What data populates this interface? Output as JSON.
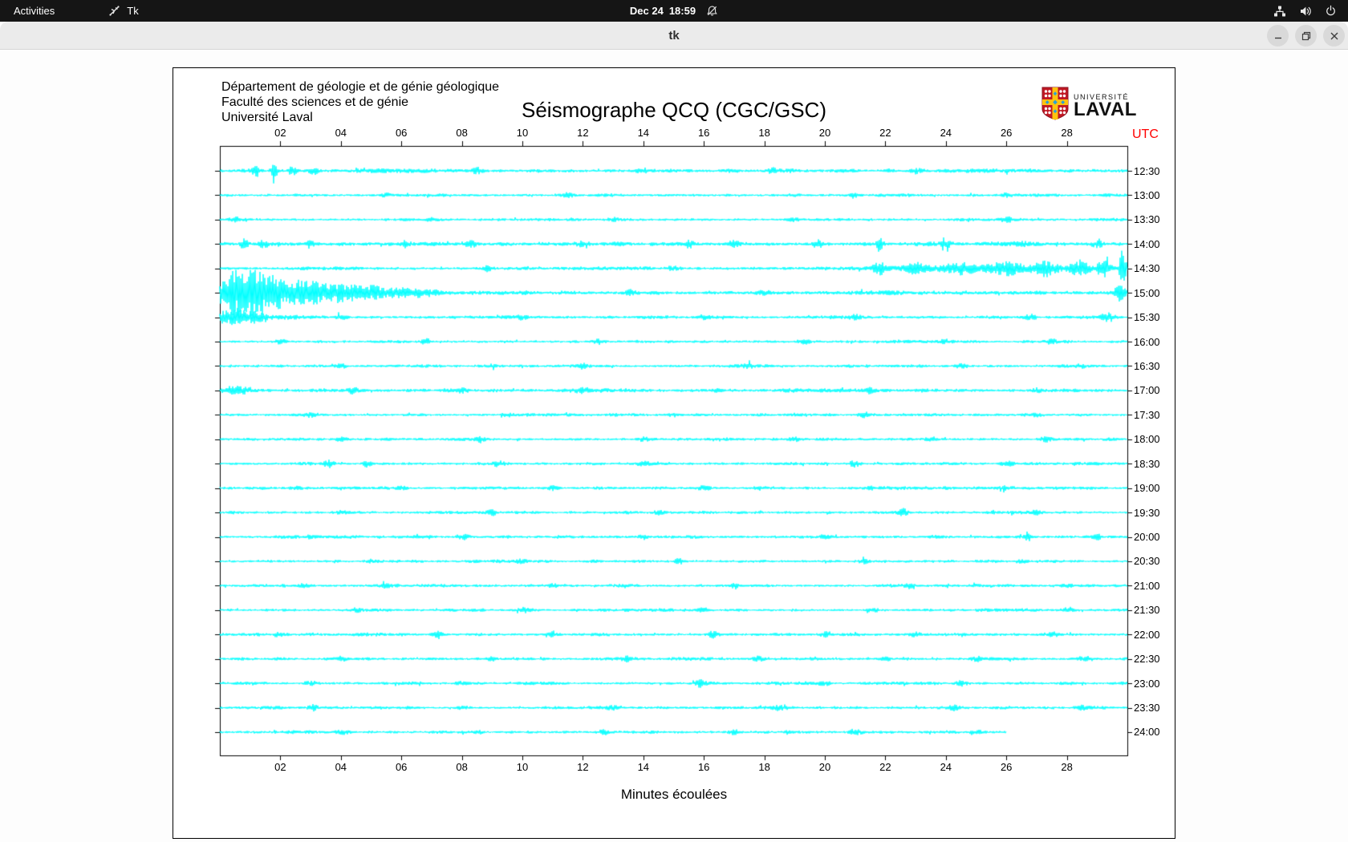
{
  "top_bar": {
    "activities_label": "Activities",
    "app_name": "Tk",
    "date": "Dec 24",
    "time": "18:59",
    "icons": {
      "app": "tk-icon",
      "notifications": "bell-muted-icon",
      "network": "wired-network-icon",
      "audio": "volume-icon",
      "power": "power-icon"
    }
  },
  "window": {
    "title": "tk",
    "buttons": [
      "minimize",
      "maximize",
      "close"
    ]
  },
  "seismograph": {
    "header_lines": [
      "Département de géologie et de génie géologique",
      "Faculté des sciences et de génie",
      "Université Laval"
    ],
    "title": "Séismographe QCQ (CGC/GSC)",
    "logo": {
      "line1": "UNIVERSITÉ",
      "line2": "LAVAL"
    },
    "utc_label": "UTC",
    "xlabel": "Minutes écoulées",
    "x_tick_labels": [
      "02",
      "04",
      "06",
      "08",
      "10",
      "12",
      "14",
      "16",
      "18",
      "20",
      "22",
      "24",
      "26",
      "28"
    ],
    "colors": {
      "trace": "#00ffff",
      "frame": "#000000",
      "utc_label": "#ff0000",
      "logo_red": "#c01823",
      "logo_yellow": "#ffc20e",
      "logo_blue": "#2b9fd8"
    },
    "chart_data": {
      "type": "line",
      "x_unit": "minutes",
      "x_range": [
        0,
        30
      ],
      "minutes_per_row": 30,
      "note": "24 half-hour seismogram sweeps, UTC 12:30 to 24:00; large event at 15:00",
      "rows": [
        {
          "utc": "12:30",
          "len": 30,
          "base": 1.9,
          "ev": [
            [
              1.2,
              6,
              0.12
            ],
            [
              1.8,
              10,
              0.1
            ],
            [
              2.4,
              6,
              0.12
            ],
            [
              3.1,
              4,
              0.15
            ],
            [
              8.5,
              3.5,
              0.2
            ],
            [
              14,
              3,
              0.2
            ],
            [
              18.3,
              2.5,
              0.2
            ],
            [
              23,
              3,
              0.2
            ]
          ]
        },
        {
          "utc": "13:00",
          "len": 30,
          "base": 1.5,
          "ev": [
            [
              5.5,
              2,
              0.2
            ],
            [
              11.5,
              2.5,
              0.2
            ],
            [
              21,
              2,
              0.2
            ],
            [
              26,
              2,
              0.2
            ]
          ]
        },
        {
          "utc": "13:30",
          "len": 30,
          "base": 1.5,
          "ev": [
            [
              0.5,
              3,
              0.2
            ],
            [
              7,
              2,
              0.2
            ],
            [
              13,
              2,
              0.25
            ],
            [
              19,
              2.2,
              0.2
            ],
            [
              26,
              3,
              0.2
            ]
          ]
        },
        {
          "utc": "14:00",
          "len": 30,
          "base": 2.1,
          "ev": [
            [
              0.8,
              6,
              0.12
            ],
            [
              1.4,
              5,
              0.12
            ],
            [
              3,
              3,
              0.2
            ],
            [
              6.1,
              4,
              0.15
            ],
            [
              8.3,
              3.5,
              0.2
            ],
            [
              12,
              3,
              0.2
            ],
            [
              15.5,
              4,
              0.2
            ],
            [
              17,
              3.5,
              0.2
            ],
            [
              19.8,
              4.5,
              0.15
            ],
            [
              21.8,
              9,
              0.1
            ],
            [
              24,
              4,
              0.15
            ],
            [
              26.5,
              3,
              0.2
            ],
            [
              29,
              3.5,
              0.2
            ]
          ]
        },
        {
          "utc": "14:30",
          "len": 30,
          "base": 1.7,
          "ev": [
            [
              8.9,
              4,
              0.15
            ],
            [
              15,
              2.5,
              0.2
            ],
            [
              21.8,
              7,
              0.2
            ],
            [
              23,
              5,
              0.3
            ],
            [
              24.5,
              5,
              0.4
            ],
            [
              25.5,
              3,
              4
            ],
            [
              26,
              6,
              0.4
            ],
            [
              27.3,
              7,
              0.35
            ],
            [
              28.4,
              8,
              0.3
            ],
            [
              29.2,
              10,
              0.2
            ],
            [
              29.85,
              26,
              0.1
            ]
          ]
        },
        {
          "utc": "15:00",
          "len": 30,
          "base": 2.0,
          "ev": [
            [
              0.06,
              12,
              0.15
            ],
            [
              0.5,
              28,
              0.25,
              1.3
            ],
            [
              1.2,
              14,
              0.3
            ],
            [
              1.9,
              9,
              0.35
            ],
            [
              2.6,
              8,
              0.3
            ],
            [
              3.2,
              7,
              0.3
            ],
            [
              3.5,
              3,
              3
            ],
            [
              3.9,
              6,
              0.3
            ],
            [
              4.5,
              6,
              0.3
            ],
            [
              5.1,
              5,
              0.3
            ],
            [
              5.8,
              4,
              0.35
            ],
            [
              6.6,
              3.5,
              0.5
            ],
            [
              13.6,
              3,
              0.2
            ],
            [
              18,
              2.5,
              0.25
            ],
            [
              29.75,
              9,
              0.18
            ]
          ]
        },
        {
          "utc": "15:30",
          "len": 30,
          "base": 1.6,
          "ev": [
            [
              0.12,
              8,
              0.12,
              0.9
            ],
            [
              0.55,
              5,
              0.25
            ],
            [
              1.1,
              3.5,
              0.3
            ],
            [
              4,
              2.5,
              0.2
            ],
            [
              10,
              2,
              0.2
            ],
            [
              16,
              2.2,
              0.2
            ],
            [
              21,
              2,
              0.2
            ],
            [
              26.8,
              3,
              0.2
            ],
            [
              29.35,
              5,
              0.18
            ]
          ]
        },
        {
          "utc": "16:00",
          "len": 30,
          "base": 1.5,
          "ev": [
            [
              2,
              2,
              0.2
            ],
            [
              6.8,
              4,
              0.15
            ],
            [
              12.5,
              2,
              0.2
            ],
            [
              19.3,
              3,
              0.18
            ],
            [
              24,
              2,
              0.2
            ],
            [
              27.5,
              2.5,
              0.2
            ]
          ]
        },
        {
          "utc": "16:30",
          "len": 30,
          "base": 1.5,
          "ev": [
            [
              4,
              2.2,
              0.2
            ],
            [
              9,
              2,
              0.2
            ],
            [
              12,
              3,
              0.18
            ],
            [
              17.5,
              2.5,
              0.2
            ],
            [
              24.5,
              2.5,
              0.2
            ],
            [
              28.5,
              2,
              0.2
            ]
          ]
        },
        {
          "utc": "17:00",
          "len": 30,
          "base": 1.8,
          "ev": [
            [
              0.5,
              3.5,
              0.6
            ],
            [
              4.4,
              3,
              0.2
            ],
            [
              8,
              2.2,
              0.2
            ],
            [
              12,
              2.5,
              0.2
            ],
            [
              16.5,
              2,
              0.2
            ],
            [
              21.5,
              3,
              0.2
            ],
            [
              27,
              2.2,
              0.2
            ]
          ]
        },
        {
          "utc": "17:30",
          "len": 30,
          "base": 1.5,
          "ev": [
            [
              3,
              2,
              0.2
            ],
            [
              9.5,
              2.5,
              0.2
            ],
            [
              15,
              2,
              0.2
            ],
            [
              21.3,
              3,
              0.18
            ],
            [
              27,
              2,
              0.2
            ]
          ]
        },
        {
          "utc": "18:00",
          "len": 30,
          "base": 1.55,
          "ev": [
            [
              4,
              2.2,
              0.2
            ],
            [
              8.6,
              3.5,
              0.18
            ],
            [
              14,
              2.5,
              0.2
            ],
            [
              19,
              2,
              0.2
            ],
            [
              23.5,
              2.2,
              0.2
            ],
            [
              27.3,
              3,
              0.18
            ]
          ]
        },
        {
          "utc": "18:30",
          "len": 30,
          "base": 1.55,
          "ev": [
            [
              3.6,
              4,
              0.15
            ],
            [
              4.9,
              4.5,
              0.15
            ],
            [
              9.2,
              3,
              0.2
            ],
            [
              14,
              2,
              0.2
            ],
            [
              21,
              3.5,
              0.18
            ],
            [
              26,
              2.2,
              0.2
            ]
          ]
        },
        {
          "utc": "19:00",
          "len": 30,
          "base": 1.5,
          "ev": [
            [
              2.5,
              2,
              0.2
            ],
            [
              6,
              2.5,
              0.2
            ],
            [
              11,
              2,
              0.2
            ],
            [
              16,
              2.5,
              0.2
            ],
            [
              21.5,
              2,
              0.2
            ],
            [
              26,
              2.5,
              0.2
            ]
          ]
        },
        {
          "utc": "19:30",
          "len": 30,
          "base": 1.55,
          "ev": [
            [
              4,
              2,
              0.2
            ],
            [
              9,
              3,
              0.18
            ],
            [
              14.5,
              2.2,
              0.2
            ],
            [
              22.6,
              4,
              0.15
            ],
            [
              27,
              3,
              0.18
            ]
          ]
        },
        {
          "utc": "20:00",
          "len": 30,
          "base": 1.55,
          "ev": [
            [
              3,
              2,
              0.2
            ],
            [
              8,
              2.2,
              0.2
            ],
            [
              14,
              2.5,
              0.2
            ],
            [
              20,
              2,
              0.2
            ],
            [
              26.7,
              5,
              0.12
            ],
            [
              29,
              3,
              0.18
            ]
          ]
        },
        {
          "utc": "20:30",
          "len": 30,
          "base": 1.5,
          "ev": [
            [
              5,
              2,
              0.2
            ],
            [
              10,
              2.2,
              0.2
            ],
            [
              15.2,
              3.5,
              0.15
            ],
            [
              21.3,
              2.5,
              0.2
            ],
            [
              26.5,
              2,
              0.2
            ]
          ]
        },
        {
          "utc": "21:00",
          "len": 30,
          "base": 1.5,
          "ev": [
            [
              2.8,
              2,
              0.2
            ],
            [
              5.5,
              2.5,
              0.2
            ],
            [
              11,
              2,
              0.2
            ],
            [
              17,
              2.2,
              0.2
            ],
            [
              22.8,
              3.5,
              0.15
            ],
            [
              28,
              2,
              0.2
            ]
          ]
        },
        {
          "utc": "21:30",
          "len": 30,
          "base": 1.5,
          "ev": [
            [
              4.5,
              2.2,
              0.2
            ],
            [
              10,
              2.5,
              0.2
            ],
            [
              16,
              2,
              0.2
            ],
            [
              21.6,
              3,
              0.18
            ],
            [
              28,
              2.5,
              0.2
            ]
          ]
        },
        {
          "utc": "22:00",
          "len": 30,
          "base": 1.65,
          "ev": [
            [
              2,
              2.2,
              0.2
            ],
            [
              7.2,
              5,
              0.14
            ],
            [
              11,
              2,
              0.2
            ],
            [
              16.3,
              4,
              0.15
            ],
            [
              20,
              2.2,
              0.2
            ],
            [
              23,
              2.5,
              0.2
            ],
            [
              27.5,
              2.2,
              0.2
            ]
          ]
        },
        {
          "utc": "22:30",
          "len": 30,
          "base": 1.55,
          "ev": [
            [
              4,
              2.5,
              0.2
            ],
            [
              9,
              2,
              0.2
            ],
            [
              13.5,
              2.2,
              0.2
            ],
            [
              17.8,
              3,
              0.18
            ],
            [
              22,
              2,
              0.2
            ],
            [
              25,
              2.5,
              0.2
            ],
            [
              28.5,
              2,
              0.2
            ]
          ]
        },
        {
          "utc": "23:00",
          "len": 30,
          "base": 1.5,
          "ev": [
            [
              3,
              2,
              0.2
            ],
            [
              8,
              2.2,
              0.2
            ],
            [
              15.9,
              5,
              0.13
            ],
            [
              20,
              2,
              0.2
            ],
            [
              24.5,
              2.5,
              0.2
            ],
            [
              28,
              2,
              0.2
            ]
          ]
        },
        {
          "utc": "23:30",
          "len": 30,
          "base": 1.55,
          "ev": [
            [
              3.1,
              4,
              0.15
            ],
            [
              8,
              2,
              0.2
            ],
            [
              13,
              2.2,
              0.2
            ],
            [
              18.5,
              2,
              0.2
            ],
            [
              24.3,
              4,
              0.15
            ],
            [
              28.5,
              2.5,
              0.2
            ]
          ]
        },
        {
          "utc": "24:00",
          "len": 26,
          "base": 1.55,
          "ev": [
            [
              4,
              2.2,
              0.2
            ],
            [
              8.5,
              2,
              0.2
            ],
            [
              12.7,
              3,
              0.18
            ],
            [
              17,
              2.2,
              0.2
            ],
            [
              21,
              2.5,
              0.2
            ],
            [
              25,
              2,
              0.2
            ]
          ]
        }
      ]
    }
  }
}
